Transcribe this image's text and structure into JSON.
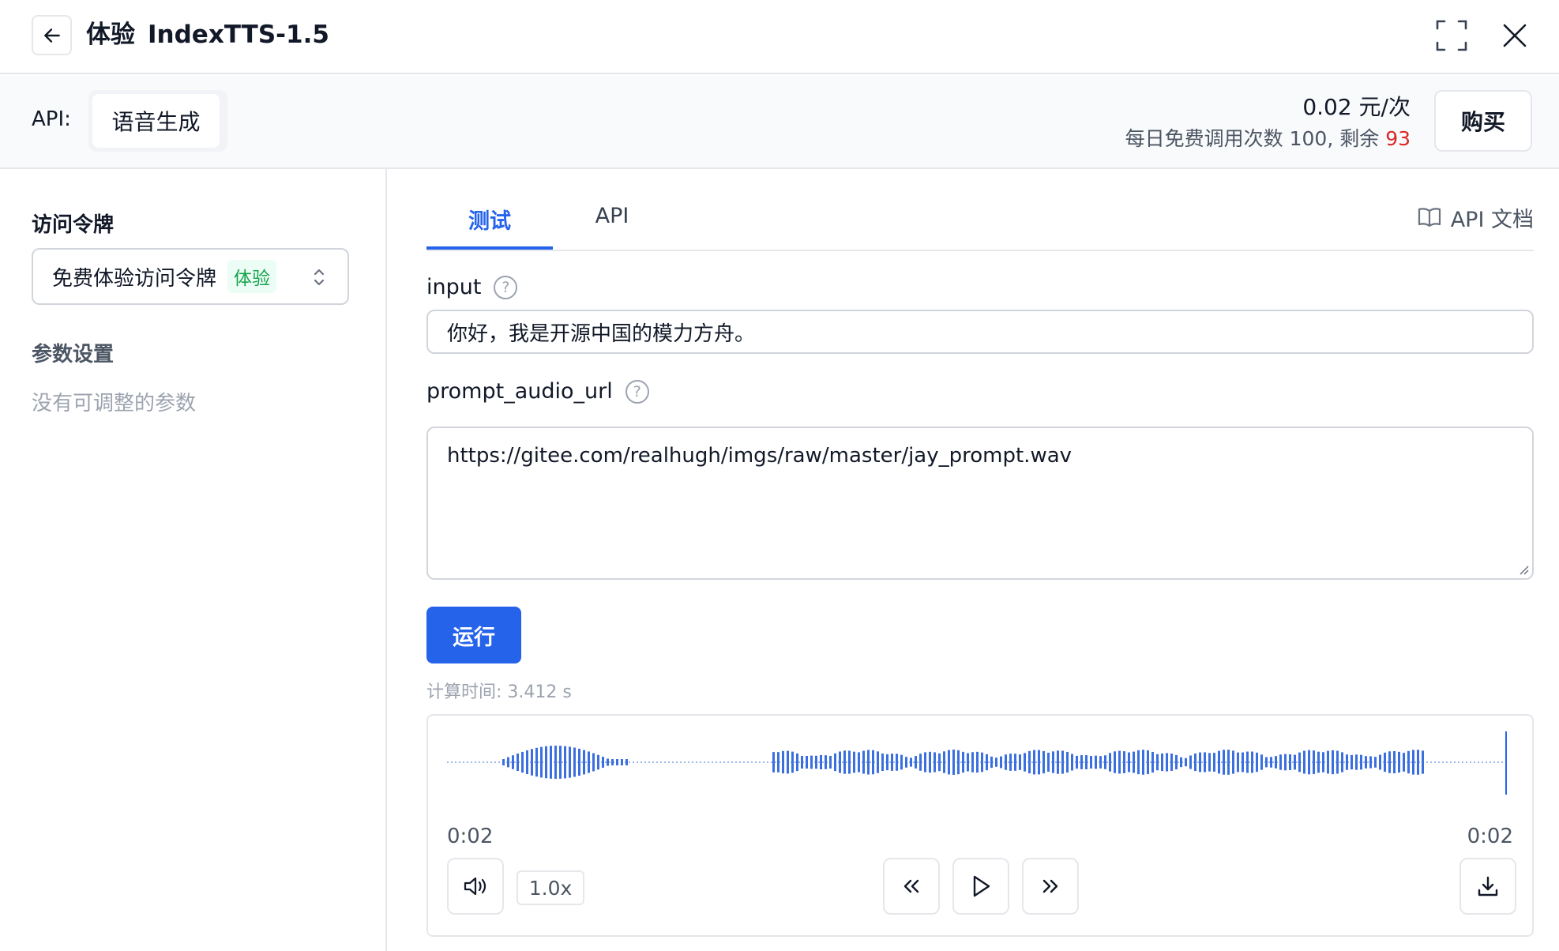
{
  "header": {
    "title_prefix": "体验",
    "title_model": "IndexTTS-1.5",
    "icons": [
      "back-arrow-icon",
      "fullscreen-icon",
      "close-icon"
    ]
  },
  "api_bar": {
    "label": "API:",
    "selected_api": "语音生成",
    "price": "0.02 元/次",
    "quota_text": "每日免费调用次数 100, 剩余 ",
    "remaining": "93",
    "buy_label": "购买"
  },
  "sidebar": {
    "token_label": "访问令牌",
    "token_value": "免费体验访问令牌",
    "token_badge": "体验",
    "params_label": "参数设置",
    "no_params": "没有可调整的参数"
  },
  "tabs": [
    {
      "label": "测试",
      "active": true
    },
    {
      "label": "API",
      "active": false
    }
  ],
  "api_doc_label": "API 文档",
  "fields": {
    "input": {
      "label": "input",
      "value": "你好，我是开源中国的模力方舟。"
    },
    "prompt_audio_url": {
      "label": "prompt_audio_url",
      "value": "https://gitee.com/realhugh/imgs/raw/master/jay_prompt.wav"
    }
  },
  "run_label": "运行",
  "calc_time": "计算时间: 3.412 s",
  "player": {
    "current_time": "0:02",
    "duration": "0:02",
    "speed": "1.0x",
    "progress": 1.0
  },
  "colors": {
    "accent": "#2563eb",
    "success": "#16a34a",
    "danger": "#dc2626",
    "waveform": "#3b6fe0"
  }
}
